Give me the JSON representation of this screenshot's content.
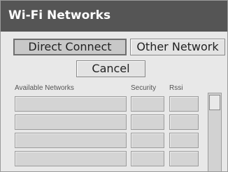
{
  "window": {
    "title": "Wi-Fi Networks"
  },
  "tabs": {
    "direct_connect": "Direct Connect",
    "other_network": "Other Network"
  },
  "actions": {
    "cancel": "Cancel"
  },
  "table": {
    "columns": [
      "Available Networks",
      "Security",
      "Rssi"
    ],
    "visible_rows": 4,
    "rows": []
  },
  "colors": {
    "titlebar": "#555555",
    "background": "#e8e8e8",
    "field": "#d4d4d4"
  }
}
